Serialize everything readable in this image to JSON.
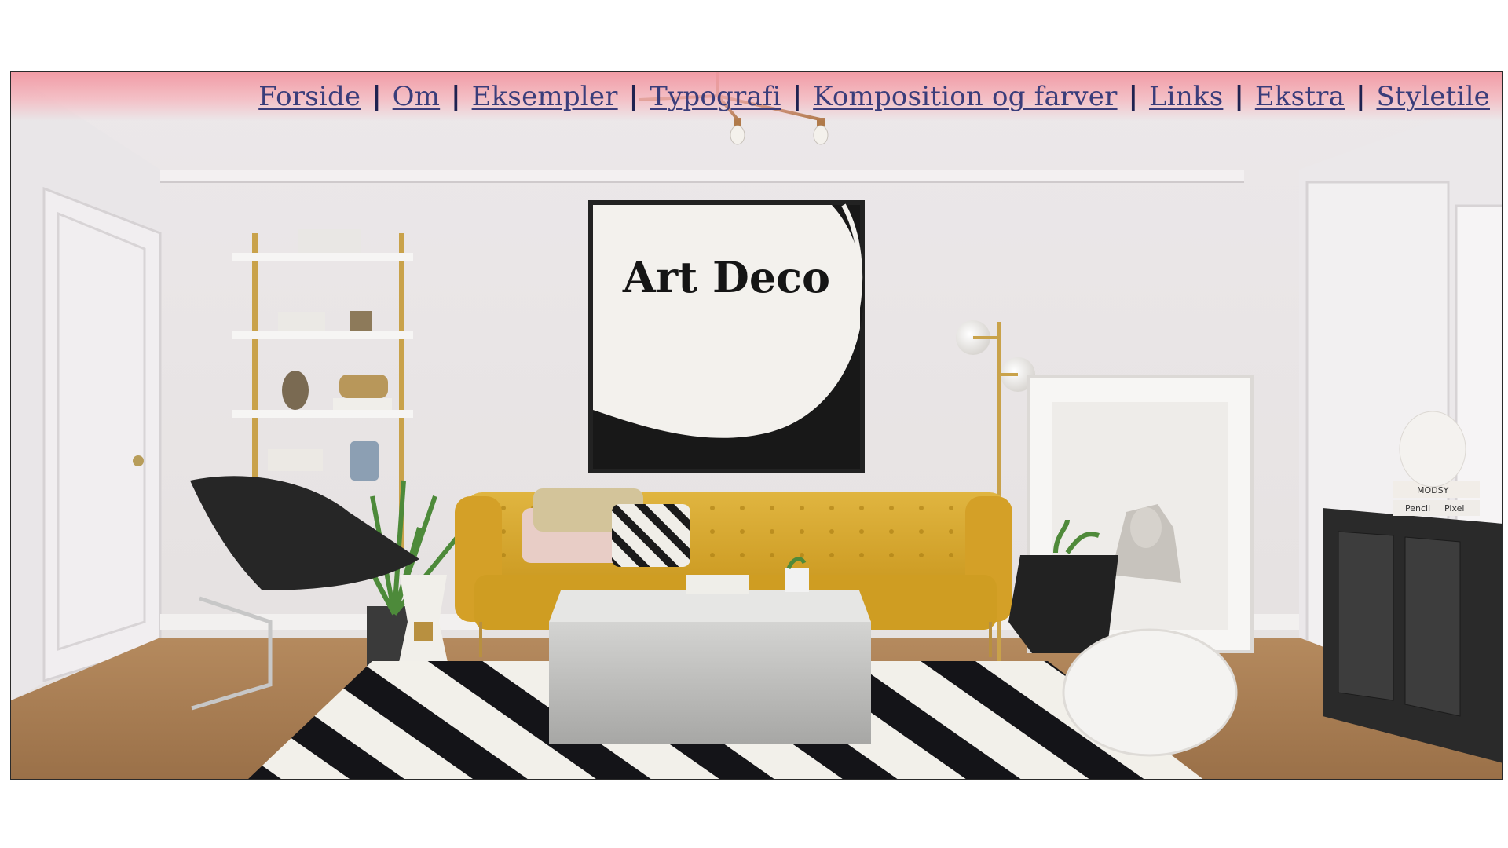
{
  "nav": {
    "items": [
      {
        "label": "Forside"
      },
      {
        "label": "Om"
      },
      {
        "label": "Eksempler"
      },
      {
        "label": "Typografi"
      },
      {
        "label": "Komposition og farver"
      },
      {
        "label": "Links"
      },
      {
        "label": "Ekstra"
      },
      {
        "label": "Styletile"
      }
    ],
    "separator": "|"
  },
  "hero": {
    "poster_title": "Art Deco",
    "box_label_brand": "MODSY",
    "box_label_1": "Pencil",
    "box_label_2": "Pixel"
  },
  "colors": {
    "nav_link": "#3a3d7a",
    "nav_background": "#f298a2",
    "sofa": "#d9a92c",
    "wall": "#e6e2e4"
  }
}
